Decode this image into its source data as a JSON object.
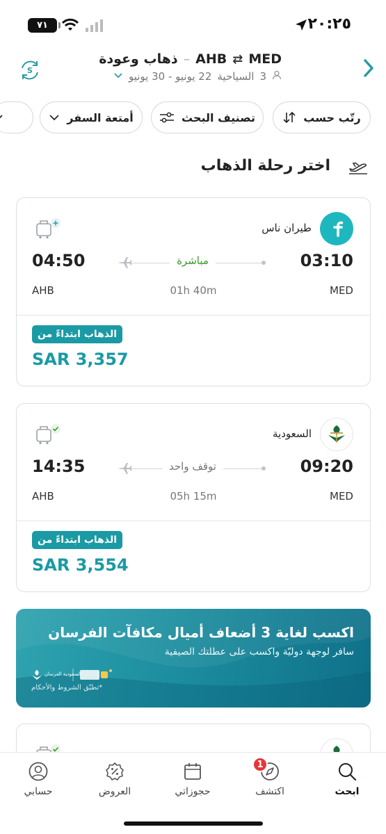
{
  "status_bar": {
    "time": "٢٠:٢٥",
    "battery": "٧١"
  },
  "header": {
    "origin": "MED",
    "destination": "AHB",
    "trip_type": "ذهاب وعودة",
    "passengers": "3",
    "cabin": "السياحية",
    "dates": "22 يونيو - 30 يونيو"
  },
  "filters": {
    "sort_label": "رتّب حسب",
    "classify_label": "تصنيف البحث",
    "baggage_label": "أمتعة السفر"
  },
  "section_title": "اختر رحلة الذهاب",
  "flights": [
    {
      "airline": "طيران ناس",
      "dep_time": "03:10",
      "arr_time": "04:50",
      "stops": "مباشرة",
      "duration": "01h 40m",
      "dep_code": "MED",
      "arr_code": "AHB",
      "badge": "الذهاب ابتداءً من",
      "price": "SAR 3,357"
    },
    {
      "airline": "السعودية",
      "dep_time": "09:20",
      "arr_time": "14:35",
      "stops": "توقف واحد",
      "duration": "05h 15m",
      "dep_code": "MED",
      "arr_code": "AHB",
      "badge": "الذهاب ابتداءً من",
      "price": "SAR 3,554"
    }
  ],
  "promo": {
    "title": "اكسب لغاية 3 أضعاف أميال مكافآت الفرسان",
    "subtitle": "سافر لوجهة دوليّة واكسب على عطلتك الصيفية",
    "terms": "*تطبّق الشروط والأحكام",
    "partner_logo_text": "السعودية الفرسان"
  },
  "bottom_nav": [
    {
      "label": "ابحث",
      "icon": "search-icon",
      "active": true
    },
    {
      "label": "اكتشف",
      "icon": "compass-icon",
      "badge": "1"
    },
    {
      "label": "حجوزاتي",
      "icon": "calendar-icon"
    },
    {
      "label": "العروض",
      "icon": "discount-icon"
    },
    {
      "label": "حسابي",
      "icon": "account-icon"
    }
  ],
  "colors": {
    "accent": "#1a9aa4",
    "direct": "#3a9a2b",
    "badge_red": "#e8343a"
  }
}
